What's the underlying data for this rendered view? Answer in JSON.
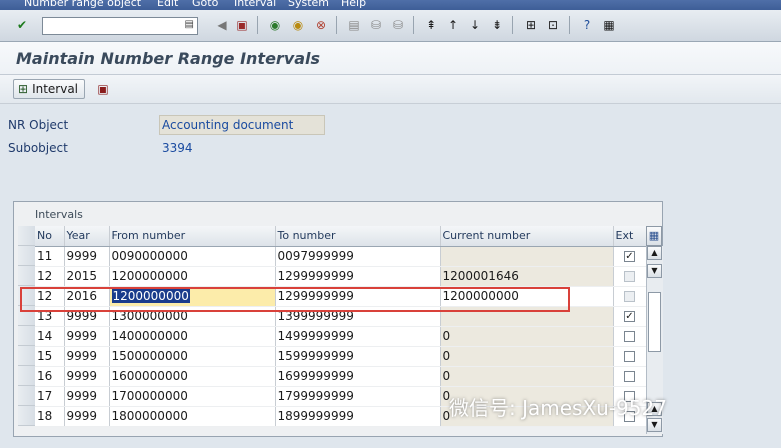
{
  "menu": [
    "Number range object",
    "Edit",
    "Goto",
    "Interval",
    "System",
    "Help"
  ],
  "command_field": {
    "value": ""
  },
  "title": "Maintain Number Range Intervals",
  "app_toolbar": {
    "interval_label": "Interval"
  },
  "header": {
    "nr_object_label": "NR Object",
    "nr_object_value": "Accounting document",
    "subobject_label": "Subobject",
    "subobject_value": "3394"
  },
  "table": {
    "caption": "Intervals",
    "columns": [
      "No",
      "Year",
      "From number",
      "To number",
      "Current number",
      "Ext"
    ],
    "rows": [
      {
        "no": "11",
        "year": "9999",
        "from": "0090000000",
        "to": "0097999999",
        "current": "",
        "ext": true,
        "ext_enabled": true
      },
      {
        "no": "12",
        "year": "2015",
        "from": "1200000000",
        "to": "1299999999",
        "current": "1200001646",
        "ext": false,
        "ext_enabled": false
      },
      {
        "no": "12",
        "year": "2016",
        "from": "1200000000",
        "to": "1299999999",
        "current": "1200000000",
        "ext": false,
        "ext_enabled": false
      },
      {
        "no": "13",
        "year": "9999",
        "from": "1300000000",
        "to": "1399999999",
        "current": "",
        "ext": true,
        "ext_enabled": true
      },
      {
        "no": "14",
        "year": "9999",
        "from": "1400000000",
        "to": "1499999999",
        "current": "0",
        "ext": false,
        "ext_enabled": true
      },
      {
        "no": "15",
        "year": "9999",
        "from": "1500000000",
        "to": "1599999999",
        "current": "0",
        "ext": false,
        "ext_enabled": true
      },
      {
        "no": "16",
        "year": "9999",
        "from": "1600000000",
        "to": "1699999999",
        "current": "0",
        "ext": false,
        "ext_enabled": true
      },
      {
        "no": "17",
        "year": "9999",
        "from": "1700000000",
        "to": "1799999999",
        "current": "0",
        "ext": false,
        "ext_enabled": true
      },
      {
        "no": "18",
        "year": "9999",
        "from": "1800000000",
        "to": "1899999999",
        "current": "0",
        "ext": false,
        "ext_enabled": true
      }
    ]
  },
  "watermark": "微信号: JamesXu-9527",
  "colors": {
    "menu_bg": "#4f6fa8",
    "highlight_border": "#d9413a",
    "selection": "#1a3c8c",
    "field_highlight": "#fcecaa"
  }
}
